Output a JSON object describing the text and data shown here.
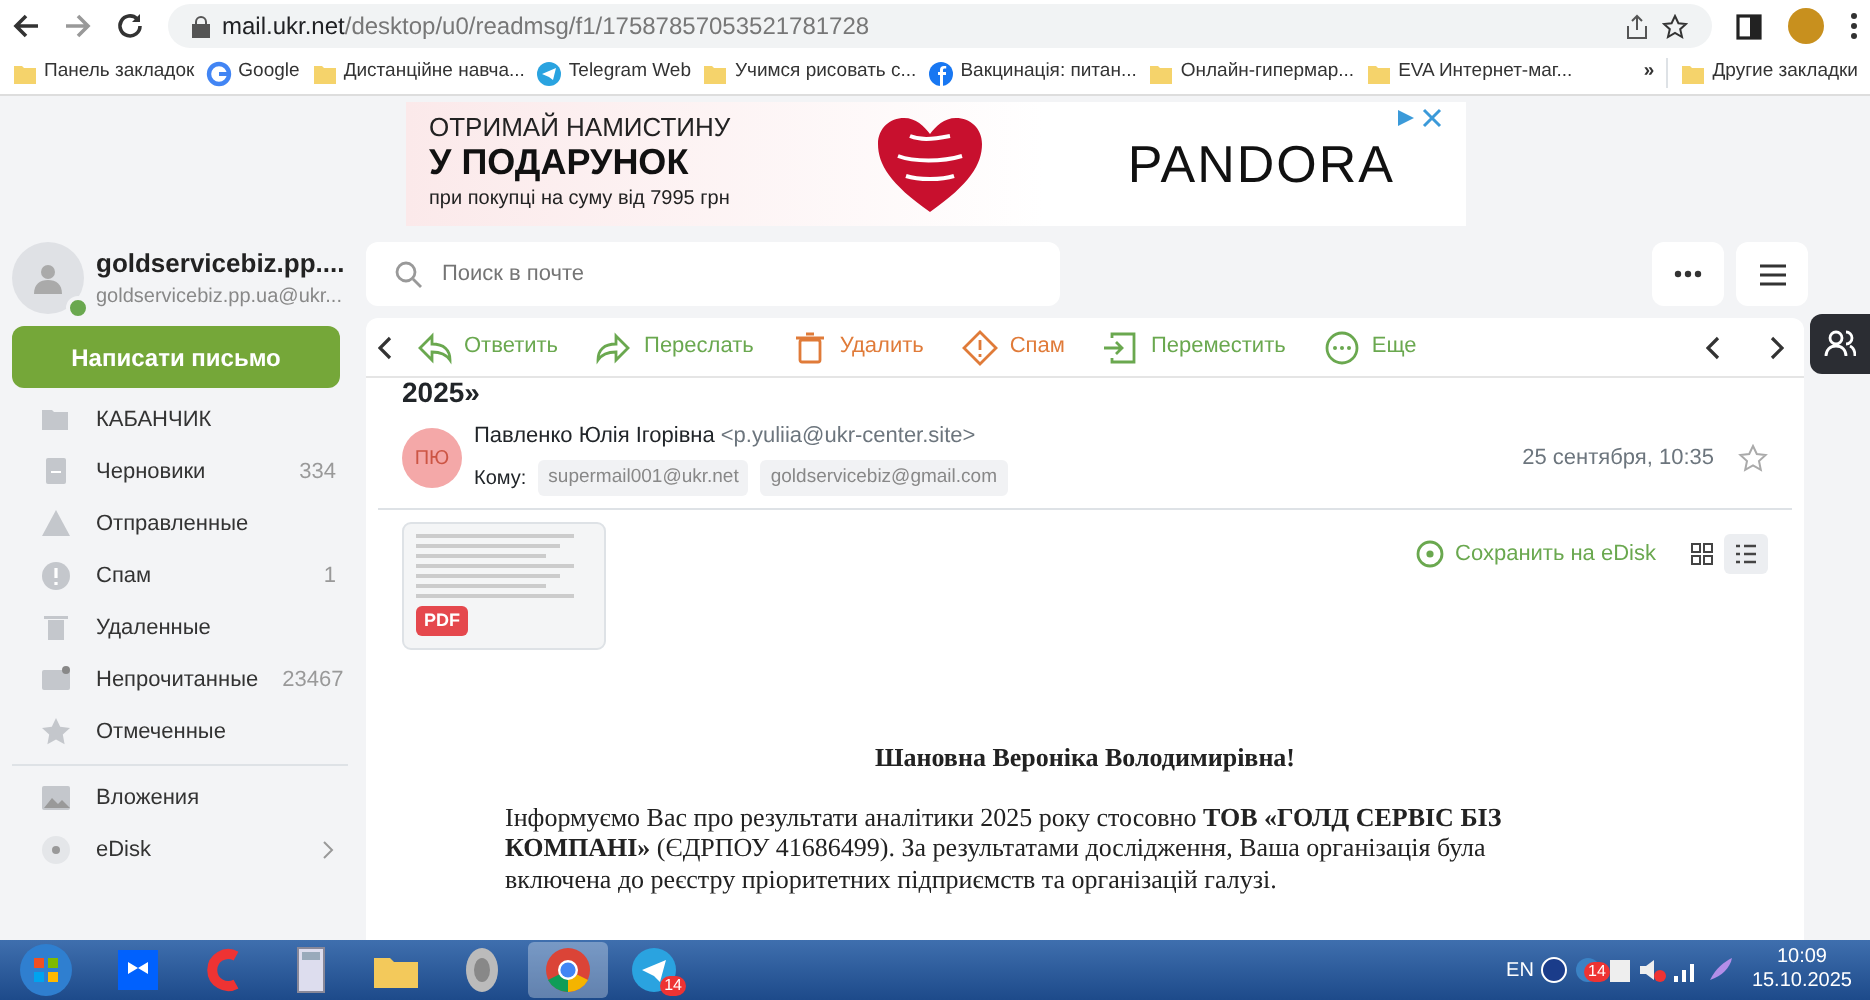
{
  "browser": {
    "address": "mail.ukr.net/desktop/u0/readmsg/f1/17587857053521781728",
    "bookmarks": [
      {
        "label": "Панель закладок",
        "kind": "folder"
      },
      {
        "label": "Google",
        "kind": "google"
      },
      {
        "label": "Дистанційне навча...",
        "kind": "folder"
      },
      {
        "label": "Telegram Web",
        "kind": "telegram"
      },
      {
        "label": "Учимся рисовать с...",
        "kind": "folder"
      },
      {
        "label": "Вакцинація: питан...",
        "kind": "facebook"
      },
      {
        "label": "Онлайн-гипермар...",
        "kind": "folder"
      },
      {
        "label": "EVA Интернет-маг...",
        "kind": "folder"
      }
    ],
    "overflow": "»",
    "other_bookmarks": "Другие закладки"
  },
  "ad": {
    "line1": "ОТРИМАЙ НАМИСТИНУ",
    "line2": "У ПОДАРУНОК",
    "line3": "при покупці на суму від 7995 грн",
    "brand": "PANDORA"
  },
  "account": {
    "name": "goldservicebiz.pp....",
    "email": "goldservicebiz.pp.ua@ukr..."
  },
  "compose": "Написати письмо",
  "search": {
    "placeholder": "Поиск в почте"
  },
  "folders": [
    {
      "label": "КАБАНЧИК",
      "kind": "folder"
    },
    {
      "label": "Черновики",
      "kind": "drafts",
      "count": "334"
    },
    {
      "label": "Отправленные",
      "kind": "sent"
    },
    {
      "label": "Спам",
      "kind": "spam",
      "count": "1"
    },
    {
      "label": "Удаленные",
      "kind": "trash"
    },
    {
      "label": "Непрочитанные",
      "kind": "unread",
      "count": "23467"
    },
    {
      "label": "Отмеченные",
      "kind": "star"
    }
  ],
  "extra_folders": [
    {
      "label": "Вложения",
      "kind": "image"
    },
    {
      "label": "eDisk",
      "kind": "disk"
    }
  ],
  "toolbar": [
    {
      "label": "Ответить",
      "kind": "reply",
      "color": "#6aa84f"
    },
    {
      "label": "Переслать",
      "kind": "forward",
      "color": "#6aa84f"
    },
    {
      "label": "Удалить",
      "kind": "delete",
      "color": "#e07b39"
    },
    {
      "label": "Спам",
      "kind": "spam",
      "color": "#e07b39"
    },
    {
      "label": "Переместить",
      "kind": "move",
      "color": "#6aa84f"
    },
    {
      "label": "Еще",
      "kind": "more",
      "color": "#6aa84f"
    }
  ],
  "message": {
    "subject_fragment": "2025»",
    "avatar": "ПЮ",
    "sender": "Павленко Юлія Ігорівна",
    "sender_email": "<p.yuliia@ukr-center.site>",
    "to_label": "Кому:",
    "recipients": [
      "supermail001@ukr.net",
      "goldservicebiz@gmail.com"
    ],
    "date": "25 сентября, 10:35",
    "starred": false,
    "attachment": {
      "type": "PDF"
    },
    "save": "Сохранить на eDisk",
    "view_modes": [
      {
        "kind": "grid",
        "selected": false
      },
      {
        "kind": "list",
        "selected": true
      }
    ],
    "greeting": "Шановна Вероніка Володимирівна!",
    "paragraph": "Інформуємо Вас про результати аналітики 2025 року стосовно **ТОВ «ГОЛД СЕРВІС БІЗ КОМПАНІ»** (ЄДРПОУ 41686499). За результатами дослідження, Ваша організація була включена до реєстру пріоритетних підприємств та організацій галузі."
  },
  "taskbar": {
    "apps": [
      {
        "kind": "start"
      },
      {
        "kind": "dropbox"
      },
      {
        "kind": "ccleaner"
      },
      {
        "kind": "calculator"
      },
      {
        "kind": "explorer"
      },
      {
        "kind": "speaker"
      },
      {
        "kind": "chrome",
        "selected": true
      },
      {
        "kind": "telegram",
        "selected": false,
        "badge": "14"
      }
    ],
    "language": "EN",
    "tray_badge": "14",
    "time": "10:09",
    "date": "15.10.2025"
  }
}
